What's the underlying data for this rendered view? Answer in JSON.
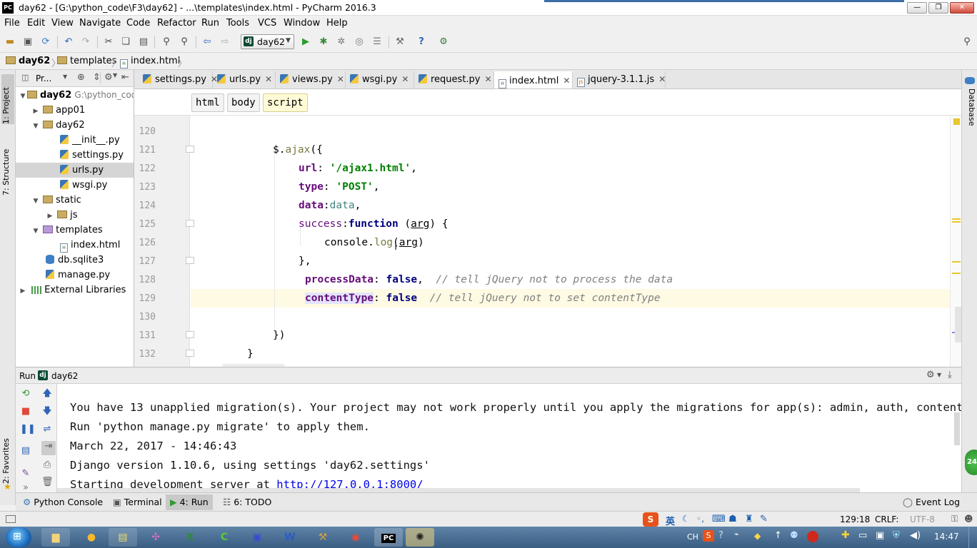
{
  "window": {
    "title": "day62 - [G:\\python_code\\F3\\day62] - ...\\templates\\index.html - PyCharm 2016.3",
    "app_icon_text": "PC"
  },
  "menu": [
    "File",
    "Edit",
    "View",
    "Navigate",
    "Code",
    "Refactor",
    "Run",
    "Tools",
    "VCS",
    "Window",
    "Help"
  ],
  "toolbar": {
    "run_config": "day62"
  },
  "breadcrumb": [
    "day62",
    "templates",
    "index.html"
  ],
  "left_tool_windows": [
    "1: Project",
    "7: Structure",
    "2: Favorites"
  ],
  "right_tool_windows": [
    "Database"
  ],
  "project": {
    "header_label": "Pr...",
    "root_name": "day62",
    "root_path": "G:\\python_code",
    "items": [
      {
        "label": "app01"
      },
      {
        "label": "day62"
      },
      {
        "label": "__init__.py"
      },
      {
        "label": "settings.py"
      },
      {
        "label": "urls.py"
      },
      {
        "label": "wsgi.py"
      },
      {
        "label": "static"
      },
      {
        "label": "js"
      },
      {
        "label": "templates"
      },
      {
        "label": "index.html"
      },
      {
        "label": "db.sqlite3"
      },
      {
        "label": "manage.py"
      },
      {
        "label": "External Libraries"
      }
    ]
  },
  "tabs": [
    "settings.py",
    "urls.py",
    "views.py",
    "wsgi.py",
    "request.py",
    "index.html",
    "jquery-3.1.1.js"
  ],
  "editor": {
    "crumbs": [
      "html",
      "body",
      "script"
    ],
    "line_numbers": [
      "120",
      "121",
      "122",
      "123",
      "124",
      "125",
      "126",
      "127",
      "128",
      "129",
      "130",
      "131",
      "132"
    ],
    "lines": {
      "l121_a": "$.",
      "l121_b": "ajax",
      "l121_c": "({",
      "l122_a": "url",
      "l122_b": ": ",
      "l122_c": "'/ajax1.html'",
      "l122_d": ",",
      "l123_a": "type",
      "l123_b": ": ",
      "l123_c": "'POST'",
      "l123_d": ",",
      "l124_a": "data",
      "l124_b": ":",
      "l124_c": "data",
      "l124_d": ",",
      "l125_a": "success",
      "l125_b": ":",
      "l125_c": "function",
      "l125_d": " (",
      "l125_e": "arg",
      "l125_f": ") {",
      "l126_a": "console.",
      "l126_b": "log",
      "l126_c": "(",
      "l126_d": "arg",
      "l126_e": ")",
      "l127_a": "},",
      "l128_a": "processData",
      "l128_b": ": ",
      "l128_c": "false",
      "l128_d": ",  ",
      "l128_e": "// tell jQuery not to process the data",
      "l129_a": "contentType",
      "l129_b": ": ",
      "l129_c": "false",
      "l129_d": "  ",
      "l129_e": "// tell jQuery not to set contentType",
      "l131_a": "})",
      "l132_a": "}"
    }
  },
  "run_panel": {
    "label": "Run",
    "config": "day62",
    "console_lines": [
      "You have 13 unapplied migration(s). Your project may not work properly until you apply the migrations for app(s): admin, auth, contenttype",
      "Run 'python manage.py migrate' to apply them.",
      "March 22, 2017 - 14:46:43",
      "Django version 1.10.6, using settings 'day62.settings'",
      "Starting development server at "
    ],
    "server_link": "http://127.0.0.1:8000/"
  },
  "bottom_tabs": [
    "Python Console",
    "Terminal",
    "4: Run",
    "6: TODO"
  ],
  "event_log": "Event Log",
  "status": {
    "position": "129:18",
    "line_sep": "CRLF:",
    "encoding": "UTF-8",
    "ime_label": "英"
  },
  "taskbar": {
    "lang": "CH",
    "clock": "14:47",
    "green_badge": "24"
  },
  "colors": {
    "keyword": "#000080",
    "property": "#660e7a",
    "string": "#008000",
    "comment": "#808080",
    "current_line": "#fffae3",
    "taskbar": "#3a5d82"
  }
}
